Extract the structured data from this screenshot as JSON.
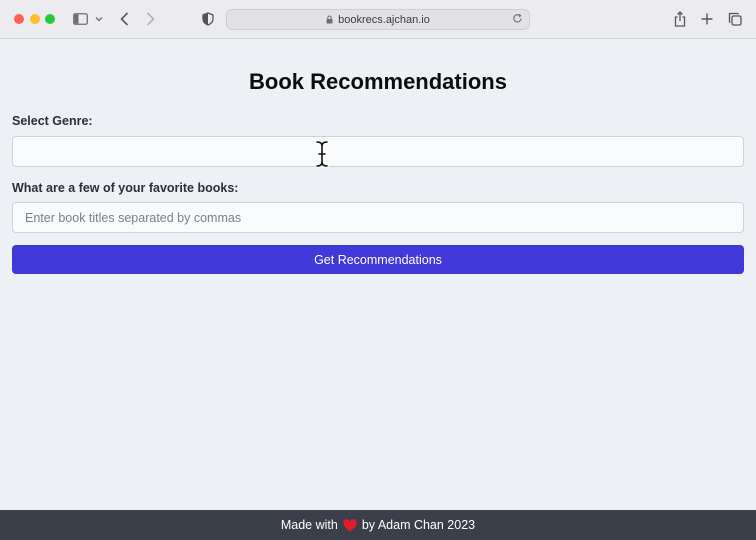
{
  "browser": {
    "url": "bookrecs.ajchan.io",
    "icons": [
      "sidebar-icon",
      "chevron-down-icon",
      "back-icon",
      "forward-icon",
      "shield-icon",
      "lock-icon",
      "reload-icon",
      "share-icon",
      "new-tab-icon",
      "tabs-overview-icon"
    ]
  },
  "page": {
    "title": "Book Recommendations",
    "genre_label": "Select Genre:",
    "genre_value": "",
    "books_label": "What are a few of your favorite books:",
    "books_placeholder": "Enter book titles separated by commas",
    "button_label": "Get Recommendations"
  },
  "footer": {
    "prefix": "Made with",
    "suffix": "by Adam Chan 2023"
  },
  "colors": {
    "accent": "#4038d8",
    "background": "#edf0f4",
    "footer": "#3a3f49",
    "heart": "#e11d2e"
  }
}
